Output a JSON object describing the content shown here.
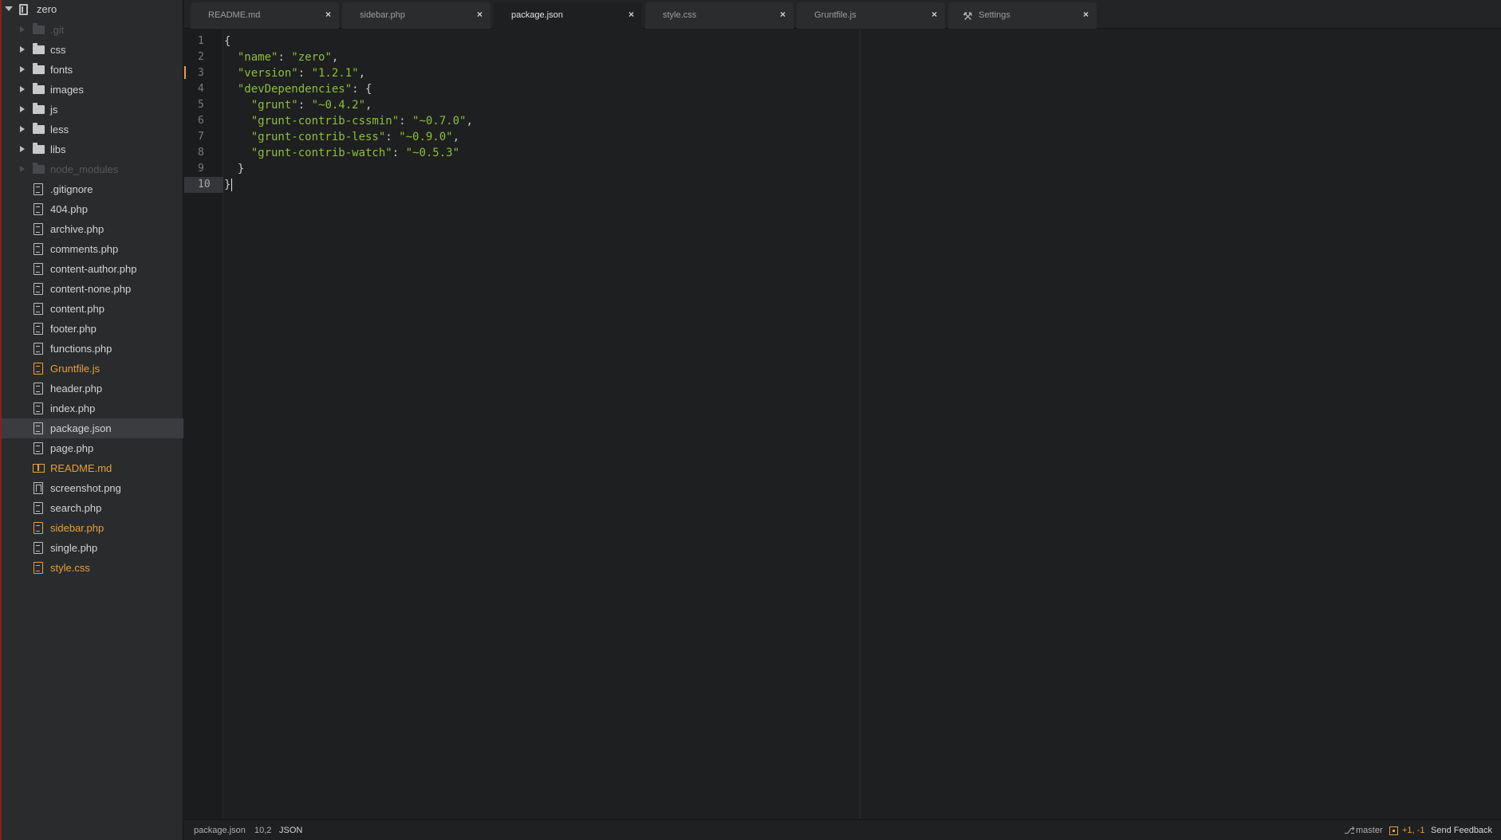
{
  "project": {
    "name": "zero"
  },
  "tree": [
    {
      "label": ".git",
      "kind": "folder",
      "state": "muted"
    },
    {
      "label": "css",
      "kind": "folder",
      "state": "normal"
    },
    {
      "label": "fonts",
      "kind": "folder",
      "state": "normal"
    },
    {
      "label": "images",
      "kind": "folder",
      "state": "normal"
    },
    {
      "label": "js",
      "kind": "folder",
      "state": "normal"
    },
    {
      "label": "less",
      "kind": "folder",
      "state": "normal"
    },
    {
      "label": "libs",
      "kind": "folder",
      "state": "normal"
    },
    {
      "label": "node_modules",
      "kind": "folder",
      "state": "muted"
    },
    {
      "label": ".gitignore",
      "kind": "file",
      "state": "normal"
    },
    {
      "label": "404.php",
      "kind": "file",
      "state": "normal"
    },
    {
      "label": "archive.php",
      "kind": "file",
      "state": "normal"
    },
    {
      "label": "comments.php",
      "kind": "file",
      "state": "normal"
    },
    {
      "label": "content-author.php",
      "kind": "file",
      "state": "normal"
    },
    {
      "label": "content-none.php",
      "kind": "file",
      "state": "normal"
    },
    {
      "label": "content.php",
      "kind": "file",
      "state": "normal"
    },
    {
      "label": "footer.php",
      "kind": "file",
      "state": "normal"
    },
    {
      "label": "functions.php",
      "kind": "file",
      "state": "normal"
    },
    {
      "label": "Gruntfile.js",
      "kind": "file",
      "state": "modified"
    },
    {
      "label": "header.php",
      "kind": "file",
      "state": "normal"
    },
    {
      "label": "index.php",
      "kind": "file",
      "state": "normal"
    },
    {
      "label": "package.json",
      "kind": "file",
      "state": "selected"
    },
    {
      "label": "page.php",
      "kind": "file",
      "state": "normal"
    },
    {
      "label": "README.md",
      "kind": "book",
      "state": "modified"
    },
    {
      "label": "screenshot.png",
      "kind": "media",
      "state": "normal"
    },
    {
      "label": "search.php",
      "kind": "file",
      "state": "normal"
    },
    {
      "label": "sidebar.php",
      "kind": "file",
      "state": "modified"
    },
    {
      "label": "single.php",
      "kind": "file",
      "state": "normal"
    },
    {
      "label": "style.css",
      "kind": "file",
      "state": "modified"
    }
  ],
  "tabs": [
    {
      "label": "README.md",
      "active": false,
      "icon": ""
    },
    {
      "label": "sidebar.php",
      "active": false,
      "icon": ""
    },
    {
      "label": "package.json",
      "active": true,
      "icon": ""
    },
    {
      "label": "style.css",
      "active": false,
      "icon": ""
    },
    {
      "label": "Gruntfile.js",
      "active": false,
      "icon": ""
    },
    {
      "label": "Settings",
      "active": false,
      "icon": "tools-icon"
    }
  ],
  "tab_close_glyph": "×",
  "editor": {
    "current_line": 10,
    "lines": [
      "{",
      "  \"name\": \"zero\",",
      "  \"version\": \"1.2.1\",",
      "  \"devDependencies\": {",
      "    \"grunt\": \"~0.4.2\",",
      "    \"grunt-contrib-cssmin\": \"~0.7.0\",",
      "    \"grunt-contrib-less\": \"~0.9.0\",",
      "    \"grunt-contrib-watch\": \"~0.5.3\"",
      "  }",
      "}"
    ]
  },
  "status": {
    "file": "package.json",
    "cursor": "10,2",
    "grammar": "JSON",
    "branch": "master",
    "diff": "+1, -1",
    "feedback": "Send Feedback"
  },
  "colors": {
    "string": "#8bbf3a",
    "modified": "#e8a03a",
    "background": "#1e1f20",
    "sidebar": "#2a2b2d"
  }
}
